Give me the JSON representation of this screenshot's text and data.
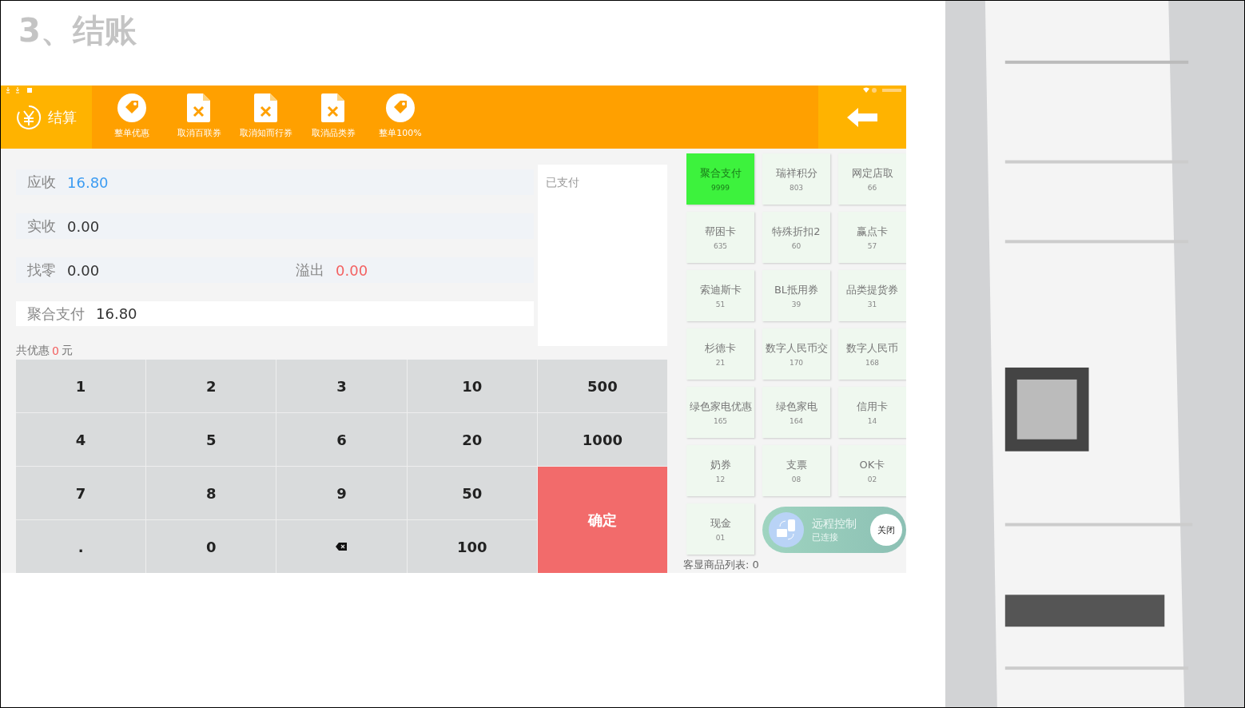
{
  "heading": "3、结账",
  "toolbar": {
    "checkout_label": "结算",
    "actions": [
      {
        "label": "整单优惠",
        "kind": "tag"
      },
      {
        "label": "取消百联券",
        "kind": "doc"
      },
      {
        "label": "取消知而行券",
        "kind": "doc"
      },
      {
        "label": "取消品类券",
        "kind": "doc"
      },
      {
        "label": "整单100%",
        "kind": "tag"
      }
    ]
  },
  "summary": [
    {
      "label": "应收",
      "value": "16.80",
      "kind": "due"
    },
    {
      "label": "实收",
      "value": "0.00",
      "kind": "plain"
    },
    {
      "label": "找零",
      "value": "0.00",
      "kind": "plain",
      "extra_label": "溢出",
      "extra_value": "0.00"
    },
    {
      "label": "聚合支付",
      "value": "16.80",
      "kind": "payment"
    }
  ],
  "paid_panel": {
    "title": "已支付"
  },
  "discount": {
    "prefix": "共优惠",
    "amount": "0",
    "unit": "元"
  },
  "keypad": [
    {
      "label": "1",
      "kind": "digit"
    },
    {
      "label": "2",
      "kind": "digit"
    },
    {
      "label": "3",
      "kind": "digit"
    },
    {
      "label": "10",
      "kind": "digit"
    },
    {
      "label": "500",
      "kind": "digit"
    },
    {
      "label": "4",
      "kind": "digit"
    },
    {
      "label": "5",
      "kind": "digit"
    },
    {
      "label": "6",
      "kind": "digit"
    },
    {
      "label": "20",
      "kind": "digit"
    },
    {
      "label": "1000",
      "kind": "digit"
    },
    {
      "label": "7",
      "kind": "digit"
    },
    {
      "label": "8",
      "kind": "digit"
    },
    {
      "label": "9",
      "kind": "digit"
    },
    {
      "label": "50",
      "kind": "digit"
    },
    {
      "label": "确定",
      "kind": "confirm"
    },
    {
      "label": ".",
      "kind": "digit"
    },
    {
      "label": "0",
      "kind": "digit"
    },
    {
      "kind": "backspace"
    },
    {
      "label": "100",
      "kind": "digit"
    }
  ],
  "payment_methods": [
    {
      "name": "聚合支付",
      "code": "9999",
      "selected": true
    },
    {
      "name": "瑞祥积分",
      "code": "803",
      "selected": false
    },
    {
      "name": "网定店取",
      "code": "66",
      "selected": false
    },
    {
      "name": "帮困卡",
      "code": "635",
      "selected": false
    },
    {
      "name": "特殊折扣2",
      "code": "60",
      "selected": false
    },
    {
      "name": "赢点卡",
      "code": "57",
      "selected": false
    },
    {
      "name": "索迪斯卡",
      "code": "51",
      "selected": false
    },
    {
      "name": "BL抵用券",
      "code": "39",
      "selected": false
    },
    {
      "name": "品类提货券",
      "code": "31",
      "selected": false
    },
    {
      "name": "杉德卡",
      "code": "21",
      "selected": false
    },
    {
      "name": "数字人民币交",
      "code": "170",
      "selected": false
    },
    {
      "name": "数字人民币",
      "code": "168",
      "selected": false
    },
    {
      "name": "绿色家电优惠",
      "code": "165",
      "selected": false
    },
    {
      "name": "绿色家电",
      "code": "164",
      "selected": false
    },
    {
      "name": "信用卡",
      "code": "14",
      "selected": false
    },
    {
      "name": "奶券",
      "code": "12",
      "selected": false
    },
    {
      "name": "支票",
      "code": "08",
      "selected": false
    },
    {
      "name": "OK卡",
      "code": "02",
      "selected": false
    },
    {
      "name": "现金",
      "code": "01",
      "selected": false
    }
  ],
  "remote_control": {
    "title": "远程控制",
    "status": "已连接",
    "close": "关闭"
  },
  "customer_display": "客显商品列表: 0"
}
